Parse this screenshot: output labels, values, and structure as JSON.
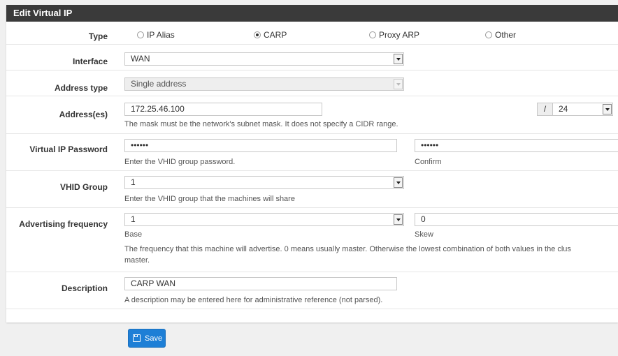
{
  "panel": {
    "title": "Edit Virtual IP"
  },
  "type": {
    "label": "Type",
    "options": [
      {
        "label": "IP Alias",
        "selected": false
      },
      {
        "label": "CARP",
        "selected": true
      },
      {
        "label": "Proxy ARP",
        "selected": false
      },
      {
        "label": "Other",
        "selected": false
      }
    ]
  },
  "interface": {
    "label": "Interface",
    "value": "WAN"
  },
  "address_type": {
    "label": "Address type",
    "value": "Single address"
  },
  "addresses": {
    "label": "Address(es)",
    "value": "172.25.46.100",
    "slash": "/",
    "mask": "24",
    "help": "The mask must be the network's subnet mask. It does not specify a CIDR range."
  },
  "password": {
    "label": "Virtual IP Password",
    "value": "••••••",
    "confirm_value": "••••••",
    "help": "Enter the VHID group password.",
    "confirm_label": "Confirm"
  },
  "vhid": {
    "label": "VHID Group",
    "value": "1",
    "help": "Enter the VHID group that the machines will share"
  },
  "advertising": {
    "label": "Advertising frequency",
    "base_value": "1",
    "skew_value": "0",
    "base_label": "Base",
    "skew_label": "Skew",
    "help_line1": "The frequency that this machine will advertise. 0 means usually master. Otherwise the lowest combination of both values in the clus",
    "help_line2": "master."
  },
  "description": {
    "label": "Description",
    "value": "CARP WAN",
    "help": "A description may be entered here for administrative reference (not parsed)."
  },
  "save": {
    "label": "Save"
  }
}
